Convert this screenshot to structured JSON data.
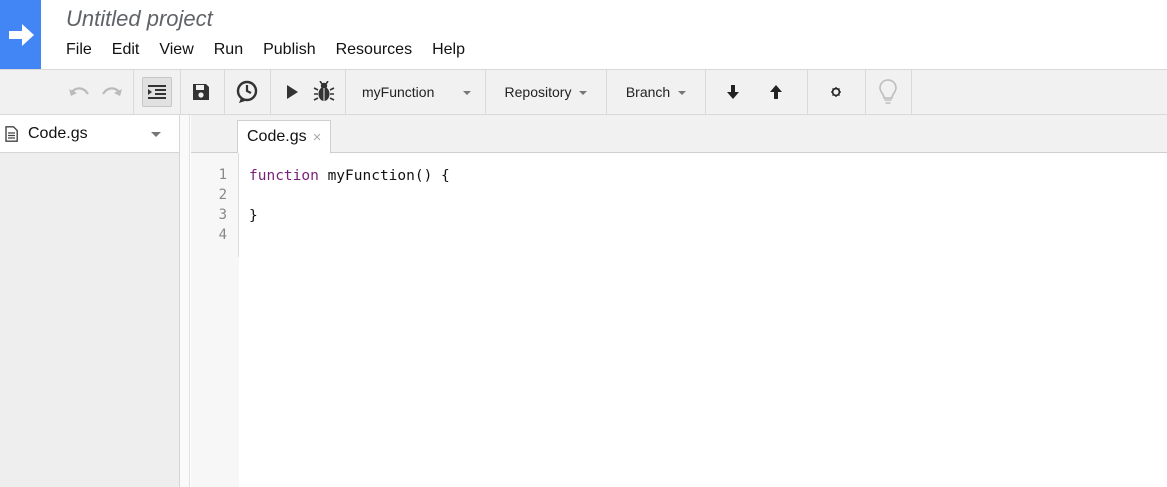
{
  "project": {
    "title": "Untitled project"
  },
  "menu": [
    "File",
    "Edit",
    "View",
    "Run",
    "Publish",
    "Resources",
    "Help"
  ],
  "toolbar": {
    "function_select": "myFunction",
    "repository": "Repository",
    "branch": "Branch"
  },
  "files": [
    {
      "name": "Code.gs"
    }
  ],
  "editor": {
    "tab": {
      "label": "Code.gs",
      "close": "×"
    },
    "line_numbers": [
      "1",
      "2",
      "3",
      "4"
    ],
    "lines": [
      {
        "kw": "function",
        "rest": " myFunction() {"
      },
      {
        "kw": "",
        "rest": ""
      },
      {
        "kw": "",
        "rest": "}"
      },
      {
        "kw": "",
        "rest": ""
      }
    ]
  },
  "colors": {
    "brand": "#4285f4",
    "keyword": "#7a1f7a",
    "toolbar_bg": "#f1f1f1",
    "sidebar_bg": "#eeeeee"
  },
  "icons": [
    "arrow-right-icon",
    "undo-icon",
    "redo-icon",
    "indent-icon",
    "save-icon",
    "triggers-clock-icon",
    "run-icon",
    "debug-bug-icon",
    "pull-down-arrow-icon",
    "push-up-arrow-icon",
    "settings-gear-icon",
    "lightbulb-icon",
    "document-icon"
  ]
}
